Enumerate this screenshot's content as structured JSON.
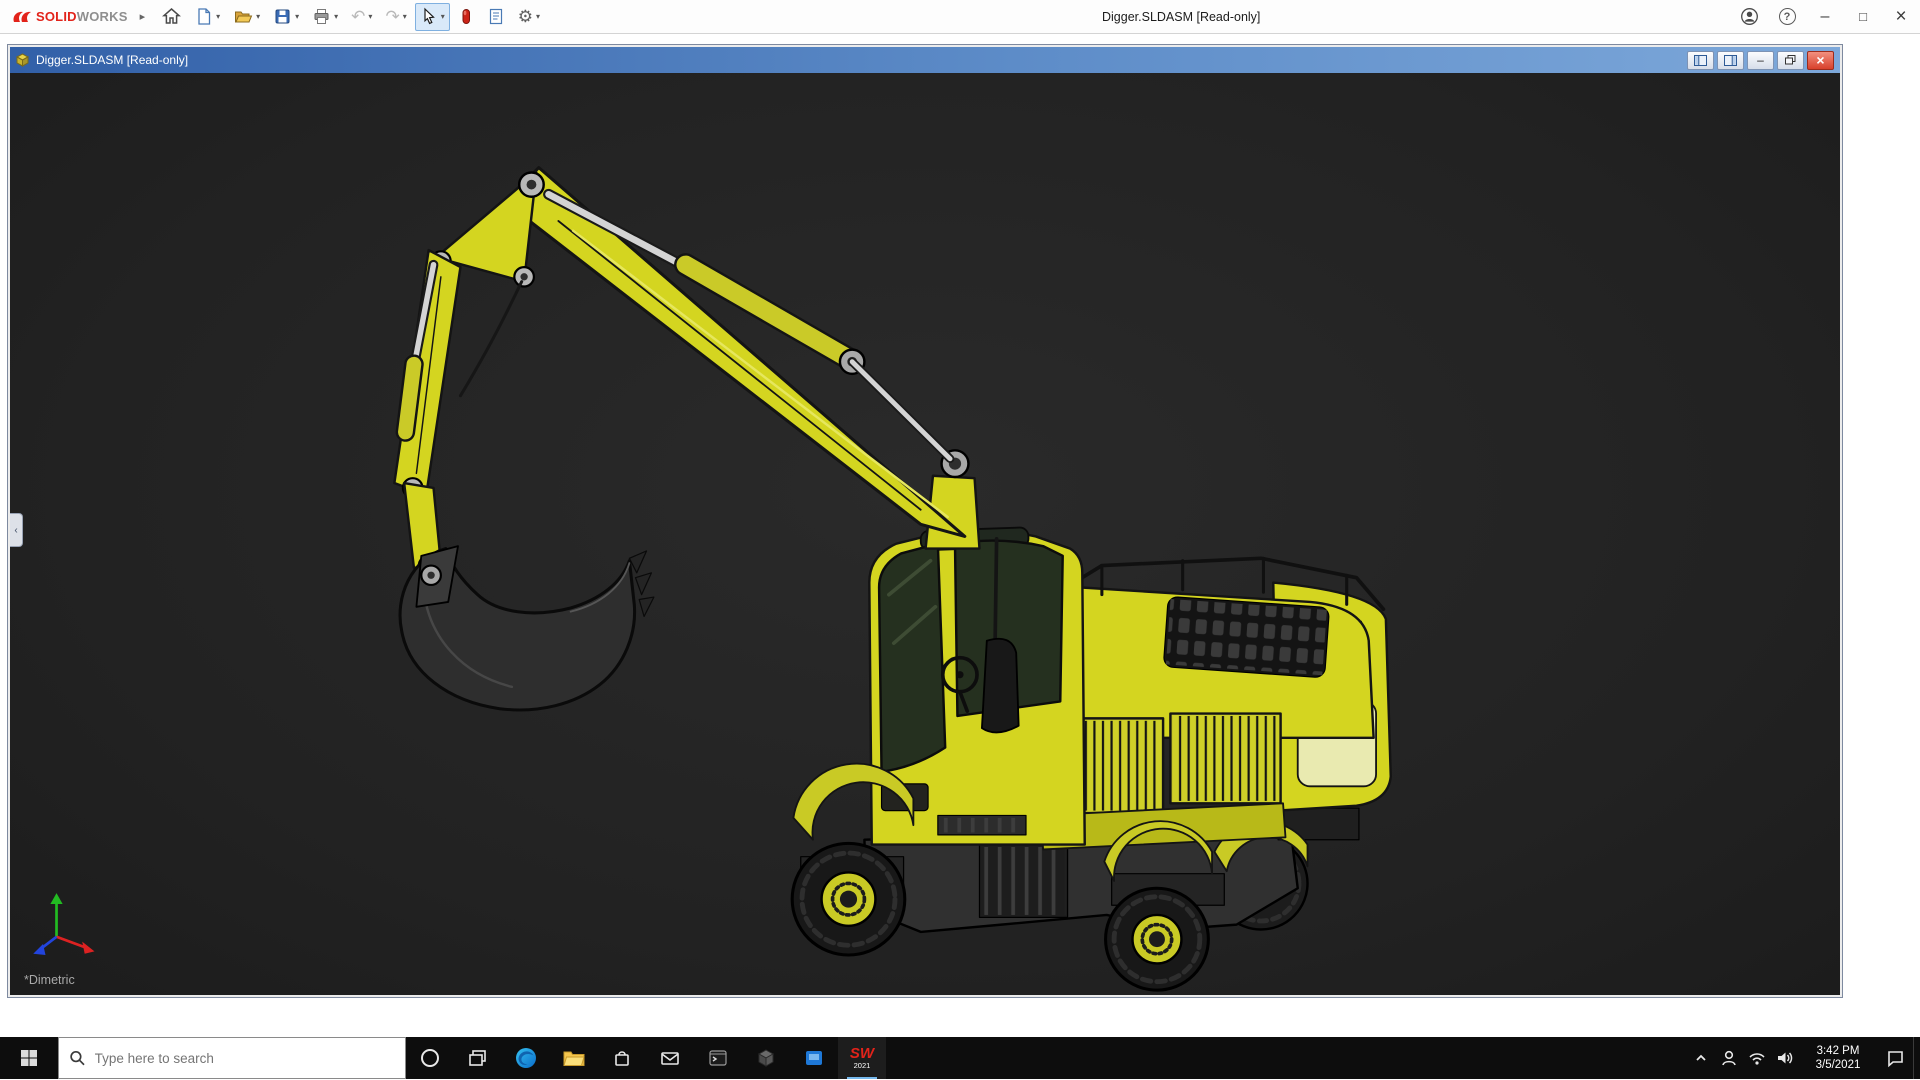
{
  "brand": {
    "solid": "SOLID",
    "works": "WORKS"
  },
  "window": {
    "title": "Digger.SLDASM [Read-only]"
  },
  "glyphs": {
    "expander": "▸",
    "caret": "▾",
    "undo": "↶",
    "redo": "↷",
    "gear": "⚙",
    "help": "?",
    "minimize": "–",
    "maximize": "□",
    "close": "×",
    "collapse": "‹"
  },
  "viewport": {
    "view_label": "*Dimetric"
  },
  "taskbar": {
    "search_placeholder": "Type here to search",
    "sw_icon": {
      "letters": "SW",
      "year": "2021"
    },
    "clock": {
      "time": "3:42 PM",
      "date": "3/5/2021"
    }
  }
}
